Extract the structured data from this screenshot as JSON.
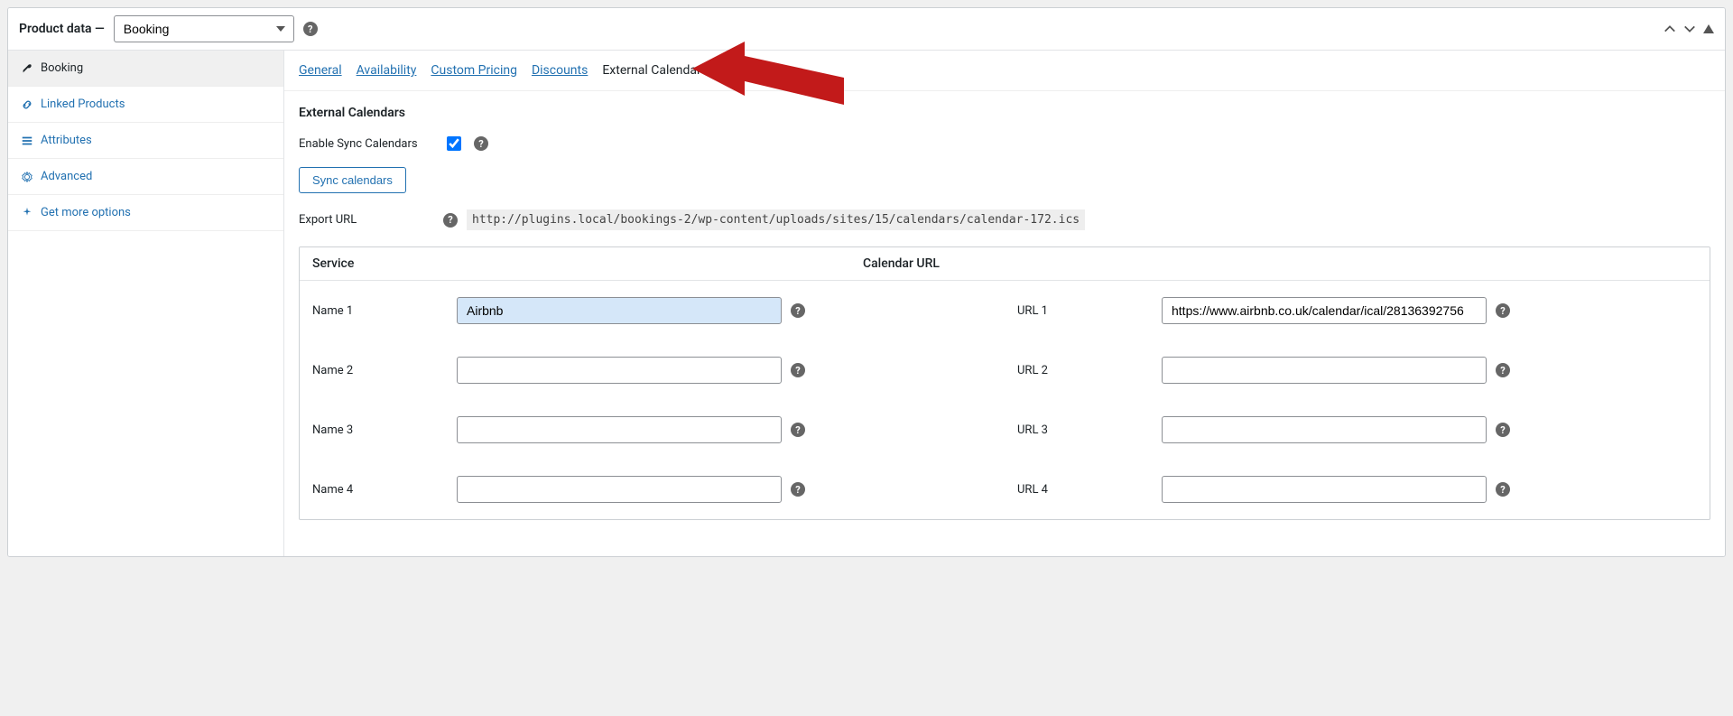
{
  "panel": {
    "title": "Product data —",
    "product_type": "Booking",
    "tools": {
      "up": "▲",
      "down": "▼",
      "collapse": "▲"
    }
  },
  "sidebar": {
    "items": [
      {
        "label": "Booking",
        "icon": "wrench",
        "active": true
      },
      {
        "label": "Linked Products",
        "icon": "link",
        "active": false
      },
      {
        "label": "Attributes",
        "icon": "list",
        "active": false
      },
      {
        "label": "Advanced",
        "icon": "gear",
        "active": false
      },
      {
        "label": "Get more options",
        "icon": "sparkle",
        "active": false
      }
    ]
  },
  "subtabs": [
    {
      "label": "General",
      "active": false
    },
    {
      "label": "Availability",
      "active": false
    },
    {
      "label": "Custom Pricing",
      "active": false
    },
    {
      "label": "Discounts",
      "active": false
    },
    {
      "label": "External Calendars",
      "active": true
    }
  ],
  "section": {
    "title": "External Calendars",
    "enable_label": "Enable Sync Calendars",
    "enable_checked": true,
    "sync_button": "Sync calendars",
    "export_label": "Export URL",
    "export_url": "http://plugins.local/bookings-2/wp-content/uploads/sites/15/calendars/calendar-172.ics"
  },
  "table": {
    "head_service": "Service",
    "head_url": "Calendar URL",
    "rows": [
      {
        "name_label": "Name 1",
        "name_value": "Airbnb",
        "url_label": "URL 1",
        "url_value": "https://www.airbnb.co.uk/calendar/ical/28136392756"
      },
      {
        "name_label": "Name 2",
        "name_value": "",
        "url_label": "URL 2",
        "url_value": ""
      },
      {
        "name_label": "Name 3",
        "name_value": "",
        "url_label": "URL 3",
        "url_value": ""
      },
      {
        "name_label": "Name 4",
        "name_value": "",
        "url_label": "URL 4",
        "url_value": ""
      }
    ]
  }
}
